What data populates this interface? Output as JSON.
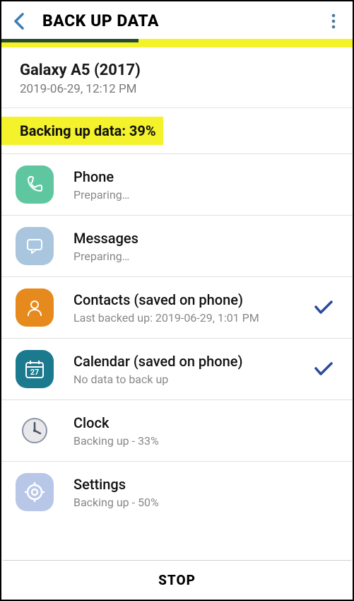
{
  "header": {
    "title": "BACK UP DATA"
  },
  "progress": {
    "percent": 39
  },
  "device": {
    "name": "Galaxy A5 (2017)",
    "timestamp": "2019-06-29, 12:12 PM"
  },
  "status": {
    "text": "Backing up data: 39%"
  },
  "items": [
    {
      "title": "Phone",
      "sub": "Preparing…",
      "done": false
    },
    {
      "title": "Messages",
      "sub": "Preparing…",
      "done": false
    },
    {
      "title": "Contacts (saved on phone)",
      "sub": "Last backed up: 2019-06-29, 1:01 PM",
      "done": true
    },
    {
      "title": "Calendar (saved on phone)",
      "sub": "No data to back up",
      "done": true
    },
    {
      "title": "Clock",
      "sub": "Backing up - 33%",
      "done": false
    },
    {
      "title": "Settings",
      "sub": "Backing up - 50%",
      "done": false
    }
  ],
  "footer": {
    "stop": "STOP"
  }
}
